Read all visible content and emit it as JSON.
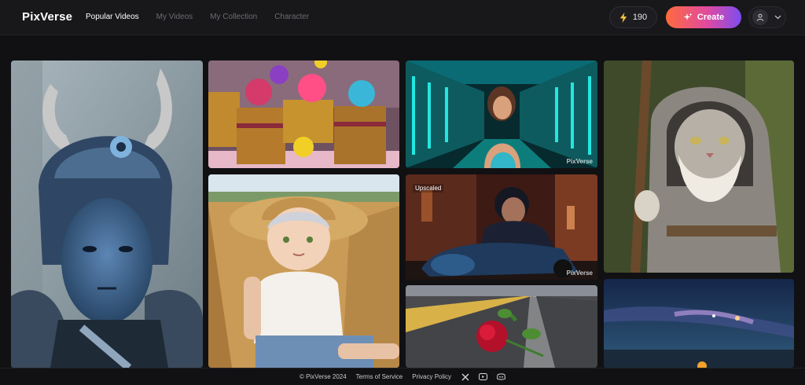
{
  "header": {
    "logo": "PixVerse",
    "nav": [
      "Popular Videos",
      "My Videos",
      "My Collection",
      "Character"
    ],
    "credits": "190",
    "create_label": "Create"
  },
  "gallery": {
    "badge_upscaled": "Upscaled",
    "watermark": "PixVerse"
  },
  "footer": {
    "copyright": "© PixVerse 2024",
    "terms": "Terms of Service",
    "privacy": "Privacy Policy"
  },
  "colors": {
    "background": "#111113",
    "topbar": "#18181b",
    "accent_start": "#ff6a3d",
    "accent_end": "#7e4cf0"
  },
  "icons": [
    "bolt-icon",
    "sparkle-icon",
    "user-icon",
    "chevron-down-icon",
    "x-logo-icon",
    "youtube-icon",
    "discord-icon"
  ]
}
